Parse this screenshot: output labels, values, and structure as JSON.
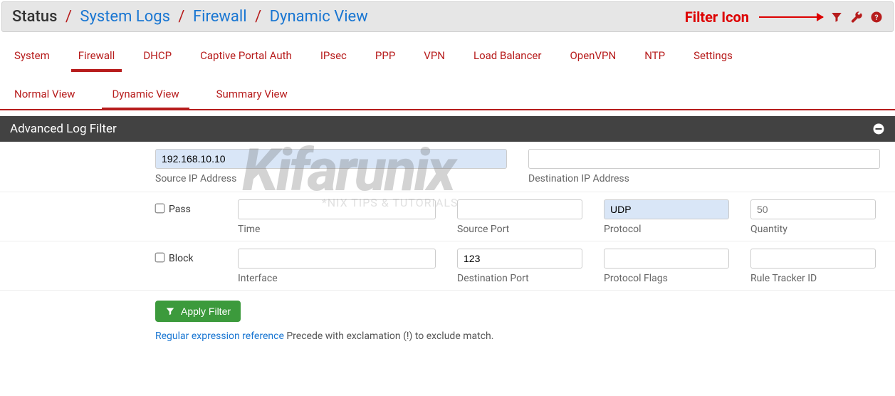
{
  "breadcrumb": {
    "root": "Status",
    "items": [
      "System Logs",
      "Firewall",
      "Dynamic View"
    ]
  },
  "annotation": {
    "filter_label": "Filter Icon"
  },
  "tabs": [
    "System",
    "Firewall",
    "DHCP",
    "Captive Portal Auth",
    "IPsec",
    "PPP",
    "VPN",
    "Load Balancer",
    "OpenVPN",
    "NTP",
    "Settings"
  ],
  "active_tab": "Firewall",
  "subtabs": [
    "Normal View",
    "Dynamic View",
    "Summary View"
  ],
  "active_subtab": "Dynamic View",
  "panel": {
    "title": "Advanced Log Filter"
  },
  "form": {
    "source_ip": {
      "value": "192.168.10.10",
      "label": "Source IP Address"
    },
    "dest_ip": {
      "value": "",
      "label": "Destination IP Address"
    },
    "pass": {
      "label": "Pass",
      "checked": false
    },
    "block": {
      "label": "Block",
      "checked": false
    },
    "time": {
      "value": "",
      "label": "Time"
    },
    "source_port": {
      "value": "",
      "label": "Source Port"
    },
    "protocol": {
      "value": "UDP",
      "label": "Protocol"
    },
    "quantity": {
      "value": "",
      "placeholder": "50",
      "label": "Quantity"
    },
    "interface": {
      "value": "",
      "label": "Interface"
    },
    "dest_port": {
      "value": "123",
      "label": "Destination Port"
    },
    "protocol_flags": {
      "value": "",
      "label": "Protocol Flags"
    },
    "rule_tracker": {
      "value": "",
      "label": "Rule Tracker ID"
    }
  },
  "actions": {
    "apply": "Apply Filter"
  },
  "helper": {
    "link": "Regular expression reference",
    "text": " Precede with exclamation (!) to exclude match."
  },
  "watermark": {
    "main": "Kifarunix",
    "sub": "*NIX TIPS & TUTORIALS"
  }
}
